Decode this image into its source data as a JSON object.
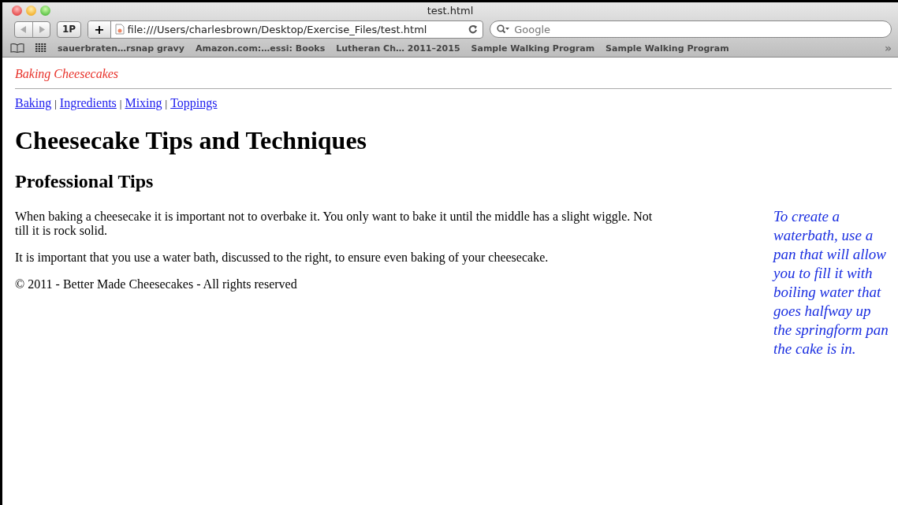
{
  "window": {
    "title": "test.html"
  },
  "toolbar": {
    "reader_button": "1P",
    "new_tab_button": "+",
    "address": "file:///Users/charlesbrown/Desktop/Exercise_Files/test.html",
    "search": {
      "placeholder": "Google"
    }
  },
  "bookmarks": [
    "sauerbraten…rsnap gravy",
    "Amazon.com:…essi: Books",
    "Lutheran Ch… 2011–2015",
    "Sample Walking Program",
    "Sample Walking Program"
  ],
  "bookmarks_overflow": "»",
  "page": {
    "site_title": "Baking Cheesecakes",
    "nav": [
      "Baking",
      "Ingredients",
      "Mixing",
      "Toppings"
    ],
    "nav_separator": "|",
    "heading": "Cheesecake Tips and Techniques",
    "subheading": "Professional Tips",
    "paragraphs": [
      "When baking a cheesecake it is important not to overbake it. You only want to bake it until the middle has a slight wiggle. Not till it is rock solid.",
      "It is important that you use a water bath, discussed to the right, to ensure even baking of your cheesecake.",
      "© 2011 - Better Made Cheesecakes - All rights reserved"
    ],
    "aside": "To create a waterbath, use a pan that will allow you to fill it with boiling water that goes halfway up the springform pan the cake is in."
  }
}
